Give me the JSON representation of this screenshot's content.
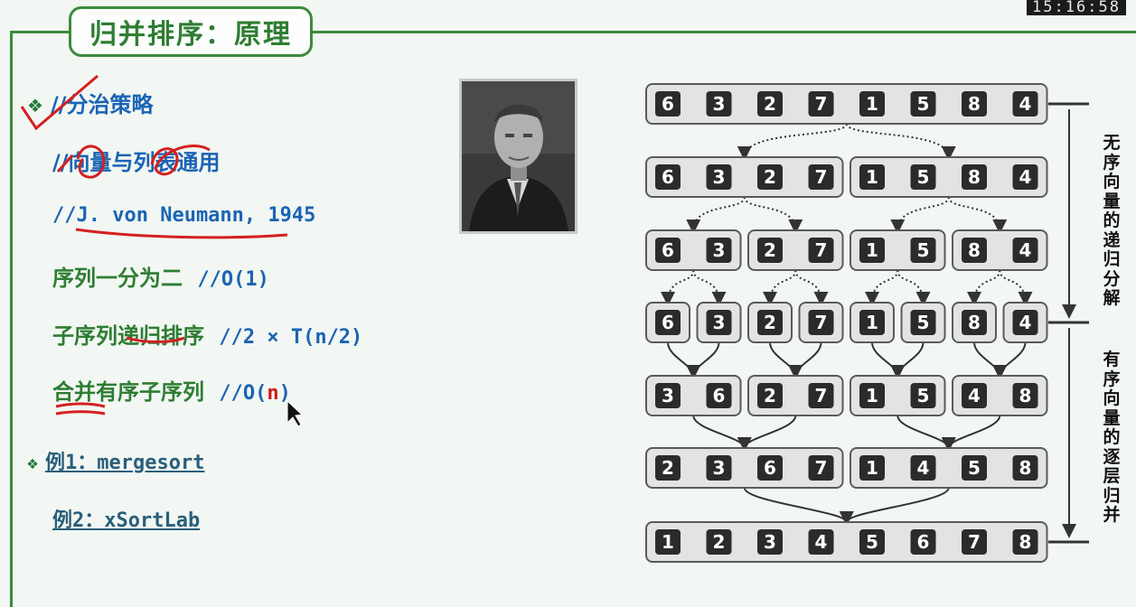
{
  "clock": "15:16:58",
  "title": "归并排序：原理",
  "left": {
    "bullet1": "//分治策略",
    "line2": "//向量与列表通用",
    "line3": "//J. von Neumann, 1945",
    "line4_a": "序列一分为二",
    "line4_b": "//O(1)",
    "line5_a": "子序列递归排序",
    "line5_b": "//2 × T(n/2)",
    "line6_a": "合并有序子序列",
    "line6_b": "//O(",
    "line6_n": "n",
    "line6_c": ")",
    "example1": "例1：mergesort",
    "example2": "例2：xSortLab"
  },
  "diagram": {
    "levels": [
      [
        [
          6,
          3,
          2,
          7,
          1,
          5,
          8,
          4
        ]
      ],
      [
        [
          6,
          3,
          2,
          7
        ],
        [
          1,
          5,
          8,
          4
        ]
      ],
      [
        [
          6,
          3
        ],
        [
          2,
          7
        ],
        [
          1,
          5
        ],
        [
          8,
          4
        ]
      ],
      [
        [
          6
        ],
        [
          3
        ],
        [
          2
        ],
        [
          7
        ],
        [
          1
        ],
        [
          5
        ],
        [
          8
        ],
        [
          4
        ]
      ],
      [
        [
          3,
          6
        ],
        [
          2,
          7
        ],
        [
          1,
          5
        ],
        [
          4,
          8
        ]
      ],
      [
        [
          2,
          3,
          6,
          7
        ],
        [
          1,
          4,
          5,
          8
        ]
      ],
      [
        [
          1,
          2,
          3,
          4,
          5,
          6,
          7,
          8
        ]
      ]
    ],
    "label_top": "无序向量的递归分解",
    "label_bottom": "有序向量的逐层归并",
    "colors": {
      "cell": "#2b2b2b",
      "cell_text": "#ffffff",
      "box": "#e3e3e3",
      "box_border": "#5a5a5a",
      "arrow": "#333333"
    }
  }
}
